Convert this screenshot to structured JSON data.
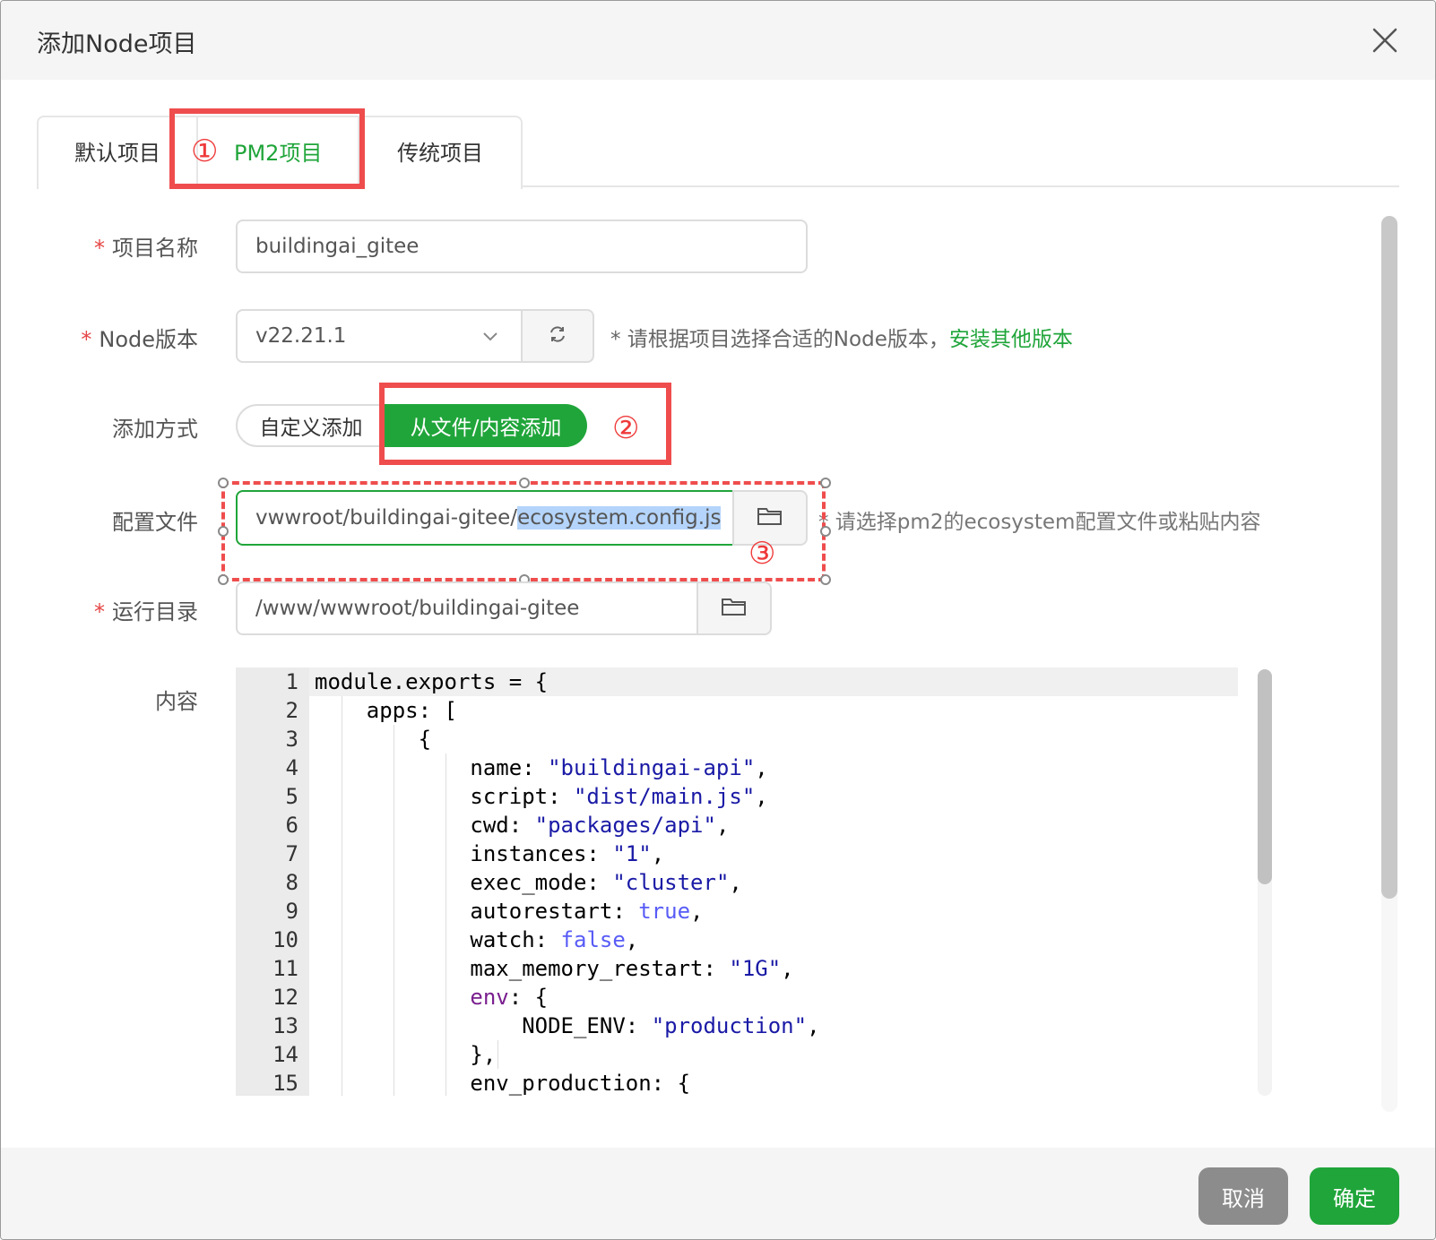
{
  "dialog": {
    "title": "添加Node项目",
    "close_icon": "close-icon"
  },
  "tabs": {
    "default": "默认项目",
    "pm2": "PM2项目",
    "traditional": "传统项目"
  },
  "form": {
    "required_mark": "*",
    "project_name": {
      "label": "项目名称",
      "value": "buildingai_gitee"
    },
    "node_version": {
      "label": "Node版本",
      "value": "v22.21.1",
      "hint": "* 请根据项目选择合适的Node版本，",
      "hint_link": "安装其他版本"
    },
    "add_method": {
      "label": "添加方式",
      "custom": "自定义添加",
      "from_file": "从文件/内容添加",
      "selected": "从文件/内容添加"
    },
    "config_file": {
      "label": "配置文件",
      "value_prefix": "vwwroot/buildingai-gitee/",
      "value_selected": "ecosystem.config.js",
      "hint": "* 请选择pm2的ecosystem配置文件或粘贴内容"
    },
    "run_dir": {
      "label": "运行目录",
      "value": "/www/wwwroot/buildingai-gitee"
    },
    "content": {
      "label": "内容"
    }
  },
  "annotations": {
    "n1": "①",
    "n2": "②",
    "n3": "③"
  },
  "code": {
    "line_numbers": [
      "1",
      "2",
      "3",
      "4",
      "5",
      "6",
      "7",
      "8",
      "9",
      "10",
      "11",
      "12",
      "13",
      "14",
      "15"
    ]
  },
  "footer": {
    "cancel": "取消",
    "confirm": "确定"
  },
  "colors": {
    "brand_green": "#20a53a",
    "annotation_red": "#ef4d4d",
    "cancel_gray": "#8c8c8c"
  }
}
